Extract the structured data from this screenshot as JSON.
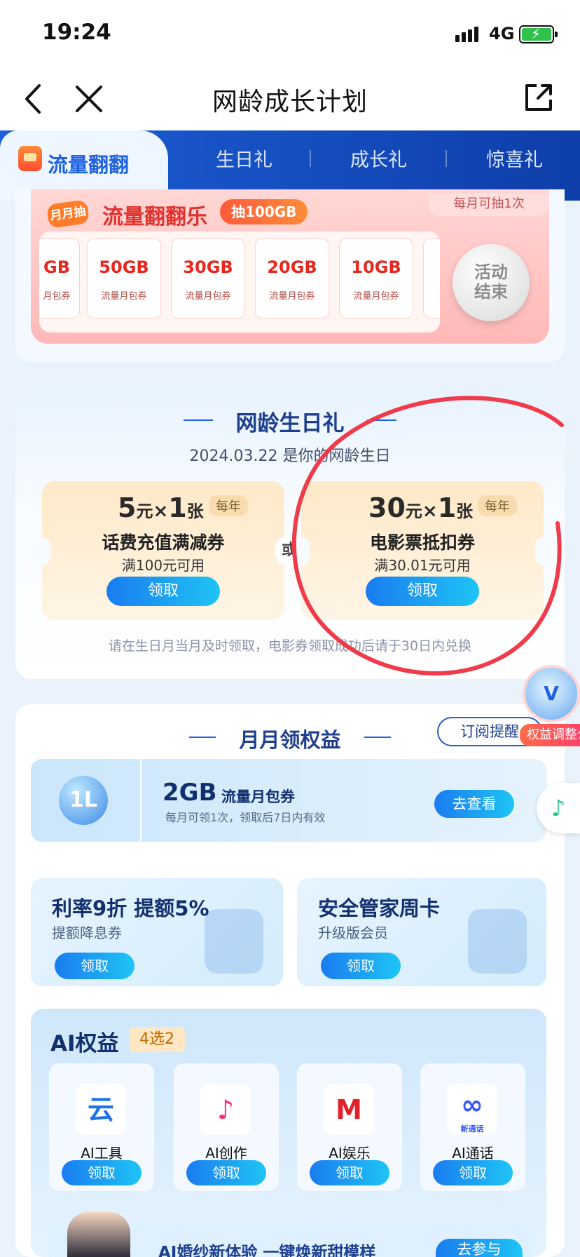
{
  "status_bar": {
    "time": "19:24",
    "network": "4G"
  },
  "nav": {
    "title": "网龄成长计划"
  },
  "tabs": [
    {
      "label": "流量翻翻"
    },
    {
      "label": "生日礼"
    },
    {
      "label": "成长礼"
    },
    {
      "label": "惊喜礼"
    }
  ],
  "flip": {
    "title": "流量翻翻乐",
    "monthly_badge": "月月抽",
    "draw_badge": "抽100GB",
    "monthly_limit": "每月可抽1次",
    "coupons": [
      {
        "amount": "GB",
        "label": "月包券"
      },
      {
        "amount": "50GB",
        "label": "流量月包券"
      },
      {
        "amount": "30GB",
        "label": "流量月包券"
      },
      {
        "amount": "20GB",
        "label": "流量月包券"
      },
      {
        "amount": "10GB",
        "label": "流量月包券"
      }
    ],
    "end_line1": "活动",
    "end_line2": "结束"
  },
  "birthday": {
    "title": "网龄生日礼",
    "subtitle": "2024.03.22 是你的网龄生日",
    "or": "或",
    "vouchers": [
      {
        "amount": "5",
        "unit": "元",
        "mult": "×",
        "count": "1",
        "count_unit": "张",
        "period": "每年",
        "name": "话费充值满减券",
        "condition": "满100元可用",
        "button": "领取"
      },
      {
        "amount": "30",
        "unit": "元",
        "mult": "×",
        "count": "1",
        "count_unit": "张",
        "period": "每年",
        "name": "电影票抵扣券",
        "condition": "满30.01元可用",
        "button": "领取"
      }
    ],
    "note": "请在生日月当月及时领取，电影券领取成功后请于30日内兑换"
  },
  "monthly": {
    "title": "月月领权益",
    "subscribe": "订阅提醒",
    "gb": {
      "amount": "2GB",
      "name": "流量月包券",
      "desc": "每月可领1次，领取后7日内有效",
      "button": "去查看"
    },
    "perks": [
      {
        "title": "利率9折 提额5%",
        "subtitle": "提额降息券",
        "button": "领取"
      },
      {
        "title": "安全管家周卡",
        "subtitle": "升级版会员",
        "button": "领取"
      }
    ],
    "ai": {
      "title": "AI权益",
      "badge": "4选2",
      "items": [
        {
          "name": "AI工具",
          "button": "领取",
          "glyph": "云",
          "color": "#1a73e8"
        },
        {
          "name": "AI创作",
          "button": "领取",
          "glyph": "♪",
          "color": "#ff2d6f"
        },
        {
          "name": "AI娱乐",
          "button": "领取",
          "glyph": "M",
          "color": "#e0202a"
        },
        {
          "name": "AI通话",
          "button": "领取",
          "glyph": "∞",
          "color": "#3355ff",
          "caption": "新通话"
        }
      ]
    },
    "wedding": {
      "text": "AI婚纱新体验 一键焕新甜模样",
      "button": "去参与"
    }
  },
  "floating": {
    "adjust_label": "权益调整公",
    "adjust_badge": "V",
    "music_icon": "♪"
  },
  "flip_tab_icon": "red-envelope-icon",
  "gb_icon_text": "1L",
  "colors": {
    "accent": "#1f63e2",
    "button": "#1a7cf0",
    "circle": "#ef3b4a"
  }
}
